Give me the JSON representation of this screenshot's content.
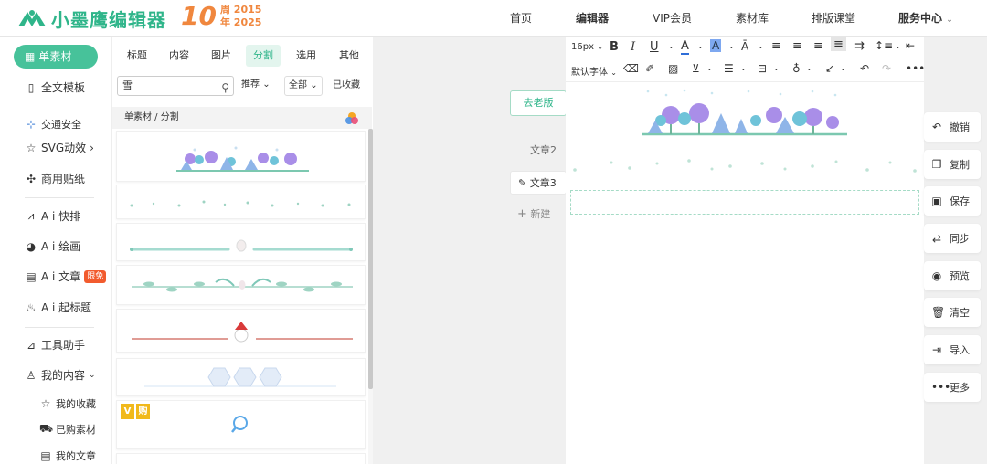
{
  "header": {
    "logo_text": "小墨鹰编辑器",
    "anniv_num": "10",
    "anniv_line1": "周 2015",
    "anniv_line2": "年 2025",
    "nav": [
      "首页",
      "编辑器",
      "VIP会员",
      "素材库",
      "排版课堂",
      "服务中心"
    ],
    "nav_active": "编辑器",
    "brand_color": "#2fb58a",
    "anniv_color": "#f0873e"
  },
  "sidebar": {
    "primary": "单素材",
    "items": [
      "全文模板",
      "交通安全",
      "SVG动效",
      "商用贴纸",
      "A i 快排",
      "A i 绘画",
      "A i 文章",
      "A i 起标题",
      "工具助手",
      "我的内容"
    ],
    "ai_article_badge": "限免",
    "sub_items": [
      "我的收藏",
      "已购素材",
      "我的文章"
    ]
  },
  "panel": {
    "tabs": [
      "标题",
      "内容",
      "图片",
      "分割",
      "选用",
      "其他"
    ],
    "active_tab": "分割",
    "search_value": "雪",
    "filters": [
      "推荐",
      "全部"
    ],
    "collected": "已收藏",
    "breadcrumb": "单素材 / 分割",
    "vip_badges": [
      "V",
      "购"
    ]
  },
  "middle": {
    "old_version": "去老版",
    "articles": [
      "文章2",
      "文章3"
    ],
    "new_label": "新建"
  },
  "editor": {
    "font_size": "16px",
    "default_font": "默认字体"
  },
  "actions": [
    "撤销",
    "复制",
    "保存",
    "同步",
    "预览",
    "清空",
    "导入",
    "更多"
  ],
  "icons": {
    "search": "search-icon",
    "undo": "undo-icon",
    "copy": "copy-icon",
    "save": "save-icon",
    "sync": "sync-icon",
    "preview": "eye-icon",
    "clear": "trash-icon",
    "import": "import-icon",
    "more": "more-icon"
  }
}
